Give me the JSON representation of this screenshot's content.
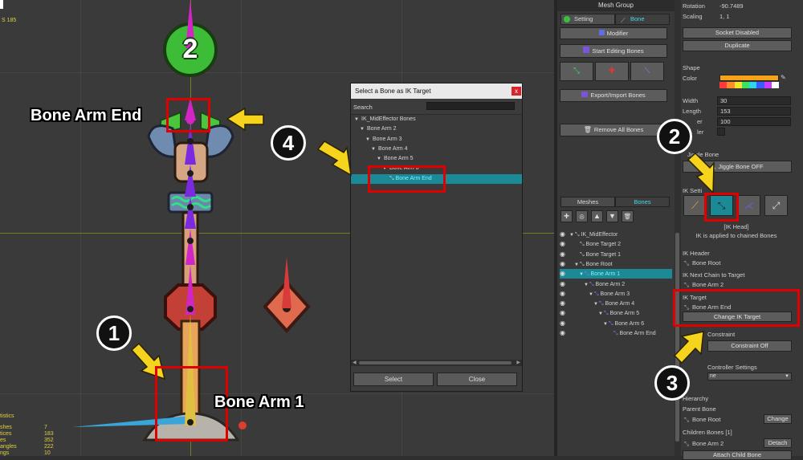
{
  "viewport": {
    "fps_label": "S 185",
    "stats": {
      "title": "tistics",
      "rows": [
        {
          "label": "shes",
          "value": "7"
        },
        {
          "label": "tices",
          "value": "183"
        },
        {
          "label": "es",
          "value": "352"
        },
        {
          "label": "angles",
          "value": "222"
        },
        {
          "label": "ngs",
          "value": "10"
        }
      ]
    },
    "badge_2": "2"
  },
  "annotations": {
    "label_bone_arm_end": "Bone Arm End",
    "label_bone_arm_1": "Bone Arm 1",
    "step1": "1",
    "step2": "2",
    "step3": "3",
    "step4": "4"
  },
  "dialog": {
    "title": "Select a Bone as IK Target",
    "close": "x",
    "search_label": "Search",
    "search_value": "",
    "tree": [
      {
        "label": "IK_MidEffector Bones",
        "depth": 0,
        "arrow": true,
        "selected": false,
        "icon": false
      },
      {
        "label": "Bone Arm 2",
        "depth": 1,
        "arrow": true,
        "selected": false,
        "icon": false
      },
      {
        "label": "Bone Arm 3",
        "depth": 2,
        "arrow": true,
        "selected": false,
        "icon": false
      },
      {
        "label": "Bone Arm 4",
        "depth": 3,
        "arrow": true,
        "selected": false,
        "icon": false
      },
      {
        "label": "Bone Arm 5",
        "depth": 4,
        "arrow": true,
        "selected": false,
        "icon": false
      },
      {
        "label": "Bone Arm 6",
        "depth": 5,
        "arrow": true,
        "selected": false,
        "icon": false
      },
      {
        "label": "Bone Arm End",
        "depth": 5,
        "arrow": false,
        "selected": true,
        "icon": true
      }
    ],
    "select_button": "Select",
    "close_button": "Close"
  },
  "left_panel": {
    "header": "Mesh Group",
    "tab_setting": "Setting",
    "tab_bone": "Bone",
    "modifier_button": "Modifier",
    "start_editing_button": "Start Editing Bones",
    "export_import_button": "Export/Import Bones",
    "remove_all_button": "Remove All Bones",
    "tab_meshes": "Meshes",
    "tab_bones": "Bones",
    "hierarchy": [
      {
        "label": "IK_MidEffector",
        "depth": 0,
        "arrow": true,
        "selected": false
      },
      {
        "label": "Bone Target 2",
        "depth": 1,
        "arrow": false,
        "selected": false
      },
      {
        "label": "Bone Target 1",
        "depth": 1,
        "arrow": false,
        "selected": false
      },
      {
        "label": "Bone Root",
        "depth": 1,
        "arrow": true,
        "selected": false
      },
      {
        "label": "Bone Arm 1",
        "depth": 2,
        "arrow": true,
        "selected": true
      },
      {
        "label": "Bone Arm 2",
        "depth": 3,
        "arrow": true,
        "selected": false
      },
      {
        "label": "Bone Arm 3",
        "depth": 4,
        "arrow": true,
        "selected": false
      },
      {
        "label": "Bone Arm 4",
        "depth": 5,
        "arrow": true,
        "selected": false
      },
      {
        "label": "Bone Arm 5",
        "depth": 6,
        "arrow": true,
        "selected": false
      },
      {
        "label": "Bone Arm 6",
        "depth": 7,
        "arrow": true,
        "selected": false
      },
      {
        "label": "Bone Arm End",
        "depth": 8,
        "arrow": false,
        "selected": false
      }
    ]
  },
  "right_panel": {
    "rotation_label": "Rotation",
    "rotation_value": "-90.7489",
    "scaling_label": "Scaling",
    "scaling_value": "1, 1",
    "socket_button": "Socket Disabled",
    "duplicate_button": "Duplicate",
    "shape_label": "Shape",
    "color_label": "Color",
    "width_label": "Width",
    "width_value": "30",
    "length_label": "Length",
    "length_value": "153",
    "taper_label": "er",
    "taper_value": "100",
    "helper_label": "ler",
    "jiggle_section": "Jiggle Bone",
    "jiggle_button": "Jiggle Bone OFF",
    "ik_setting_label": "IK Setti",
    "ik_mode_title": "[IK Head]",
    "ik_mode_desc": "IK is applied to chained Bones",
    "ik_header_label": "IK Header",
    "ik_header_value": "Bone Root",
    "ik_next_chain_label": "IK Next Chain to Target",
    "ik_next_chain_value": "Bone Arm 2",
    "ik_target_label": "IK Target",
    "ik_target_value": "Bone Arm End",
    "change_ik_target_button": "Change IK Target",
    "constraint_label": "Constraint",
    "constraint_button": "Constraint Off",
    "controller_label": "Controller Settings",
    "controller_value": "ne",
    "hierarchy_label": "Hierarchy",
    "parent_bone_label": "Parent Bone",
    "parent_bone_value": "Bone Root",
    "change_button": "Change",
    "children_label": "Children Bones [1]",
    "child_value": "Bone Arm 2",
    "detach_button": "Detach",
    "attach_button": "Attach Child Bone"
  },
  "colors": {
    "accent_teal": "#1b8a96",
    "annotation_red": "#e10000",
    "arrow_yellow": "#f6d31c",
    "bone_magenta": "#d226c4",
    "bone_purple": "#7a2be0"
  }
}
